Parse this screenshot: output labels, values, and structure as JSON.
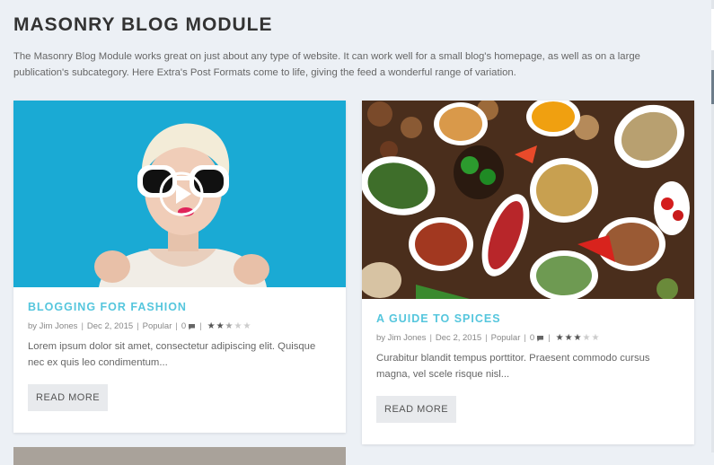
{
  "module": {
    "title": "MASONRY BLOG MODULE",
    "description": "The Masonry Blog Module works great on just about any type of website. It can work well for a small blog's homepage, as well as on a large publication's subcategory. Here Extra's Post Formats come to life, giving the feed a wonderful range of variation."
  },
  "posts": [
    {
      "title": "BLOGGING FOR FASHION",
      "author": "by Jim Jones",
      "date": "Dec 2, 2015",
      "category": "Popular",
      "comments": "0",
      "rating": 2.5,
      "excerpt": "Lorem ipsum dolor sit amet, consectetur adipiscing elit. Quisque nec ex quis leo condimentum...",
      "button": "READ MORE",
      "image": "woman-with-sunglasses-video-thumbnail"
    },
    {
      "title": "A GUIDE TO SPICES",
      "author": "by Jim Jones",
      "date": "Dec 2, 2015",
      "category": "Popular",
      "comments": "0",
      "rating": 3,
      "excerpt": "Curabitur blandit tempus porttitor. Praesent commodo cursus magna, vel scele risque nisl...",
      "button": "READ MORE",
      "image": "spices-photo"
    }
  ],
  "separator": "|",
  "colors": {
    "accent": "#55c6dd",
    "background": "#ecf0f5",
    "heading": "#333333",
    "button_bg": "#e8eaed"
  }
}
